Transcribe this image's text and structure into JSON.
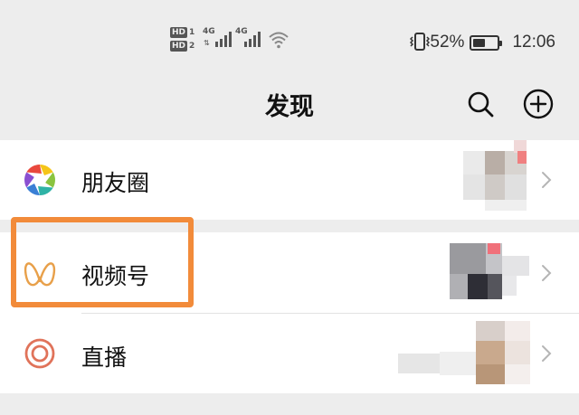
{
  "status_bar": {
    "hd1": "HD",
    "hd1_num": "1",
    "hd2": "HD",
    "hd2_num": "2",
    "net1": "4G",
    "net2": "4G",
    "battery_level": 0.52,
    "battery_text": "52%",
    "time": "12:06"
  },
  "header": {
    "title": "发现",
    "search_icon": "search-icon",
    "add_icon": "plus-circle-icon"
  },
  "menu": {
    "moments": {
      "label": "朋友圈",
      "icon": "moments-aperture-icon"
    },
    "channels": {
      "label": "视频号",
      "icon": "channels-butterfly-icon"
    },
    "live": {
      "label": "直播",
      "icon": "live-ring-icon"
    }
  },
  "colors": {
    "background": "#ededed",
    "row": "#ffffff",
    "highlight": "#f28b3a",
    "channels_icon": "#e8a04a",
    "live_icon": "#e0735a"
  }
}
